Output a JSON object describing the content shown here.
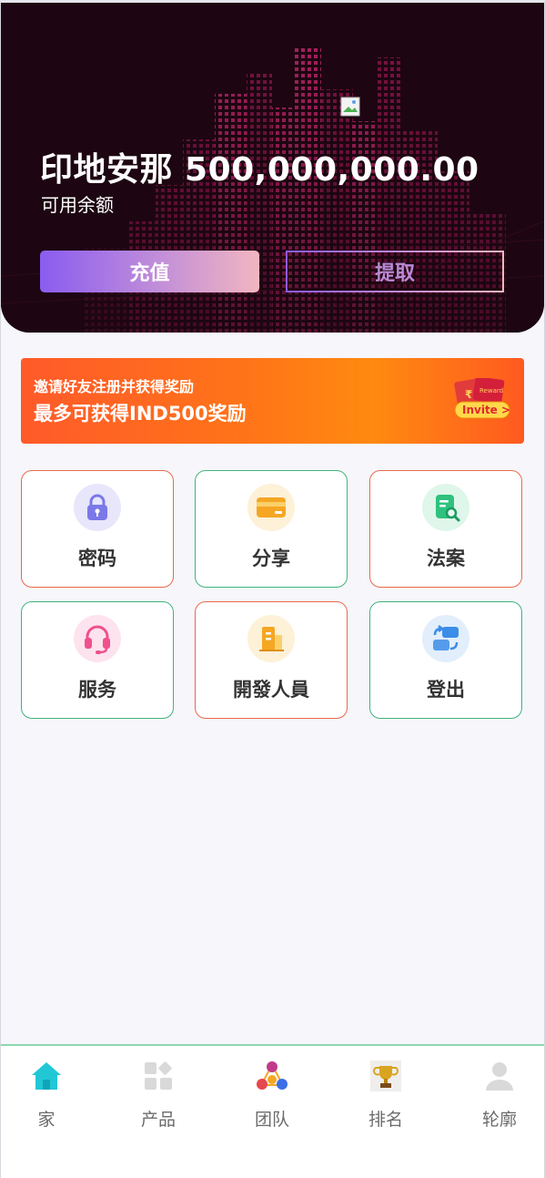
{
  "header": {
    "balance": "印地安那 500,000,000.00",
    "balance_label": "可用余额",
    "recharge_label": "充值",
    "withdraw_label": "提取"
  },
  "invite_banner": {
    "line1": "邀请好友注册并获得奖励",
    "line2": "最多可获得IND500奖励",
    "badge_text": "Invite >",
    "ticket_text": "Reward",
    "ticket_icon": "rupee-icon"
  },
  "menu": [
    {
      "label": "密码",
      "icon": "lock-icon",
      "accent": "#7b78e8"
    },
    {
      "label": "分享",
      "icon": "card-icon",
      "accent": "#f5a623"
    },
    {
      "label": "法案",
      "icon": "document-search-icon",
      "accent": "#2ec27e"
    },
    {
      "label": "服务",
      "icon": "headset-icon",
      "accent": "#f0508c"
    },
    {
      "label": "開發人員",
      "icon": "building-icon",
      "accent": "#f5a623"
    },
    {
      "label": "登出",
      "icon": "swap-icon",
      "accent": "#3b8de8"
    }
  ],
  "tabbar": [
    {
      "label": "家",
      "icon": "home-icon",
      "active": true
    },
    {
      "label": "产品",
      "icon": "grid-icon",
      "active": false
    },
    {
      "label": "团队",
      "icon": "team-icon",
      "active": false
    },
    {
      "label": "排名",
      "icon": "trophy-icon",
      "active": false
    },
    {
      "label": "轮廓",
      "icon": "profile-icon",
      "active": false
    }
  ],
  "colors": {
    "hero_bg": "#1d0611",
    "accent_purple": "#8a5cf0",
    "accent_pink": "#f2b6c0",
    "banner_orange": "#ff7418",
    "tile_red_border": "#e9684a",
    "tile_green_border": "#3fb37c",
    "tab_active": "#22c7d6"
  }
}
